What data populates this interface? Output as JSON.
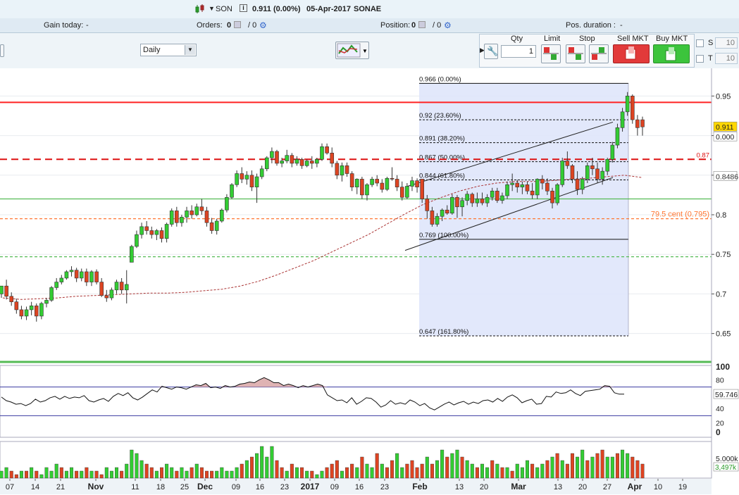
{
  "header": {
    "symbol": "SON",
    "price_info": "0.911 (0.00%)",
    "date": "05-Apr-2017",
    "name": "SONAE",
    "gain_label": "Gain today:",
    "gain_value": "-",
    "orders_label": "Orders:",
    "orders_value": "0",
    "orders_slash": "/ 0",
    "position_label": "Position:",
    "position_value": "0",
    "position_slash": "/ 0",
    "duration_label": "Pos. duration :",
    "duration_value": "-"
  },
  "toolbar": {
    "interval": "Daily",
    "qty_label": "Qty",
    "qty_value": "1",
    "limit_label": "Limit",
    "stop_label": "Stop",
    "sell_label": "Sell MKT",
    "buy_label": "Buy MKT",
    "s_label": "S",
    "s_value": "10",
    "t_label": "T",
    "t_value": "10"
  },
  "colors": {
    "up": "#33cc33",
    "down": "#dd4422",
    "resistance": "#ff2222",
    "ma": "#aa3333",
    "fib_fill": "#dfe5fb",
    "price_tag": "#ffd700"
  },
  "chart_data": [
    {
      "type": "candlestick",
      "x_ticks": [
        "07",
        "14",
        "21",
        "Nov",
        "11",
        "18",
        "25",
        "Dec",
        "09",
        "16",
        "23",
        "2017",
        "09",
        "16",
        "23",
        "Feb",
        "13",
        "20",
        "Mar",
        "13",
        "20",
        "27",
        "Apr",
        "10",
        "19"
      ],
      "y_ticks": [
        "0.95",
        "0.9",
        "0.85",
        "0.8",
        "0.75",
        "0.7",
        "0.65"
      ],
      "ylim": [
        0.615,
        0.985
      ],
      "candles": [
        [
          0.7,
          0.71,
          0.695,
          0.71
        ],
        [
          0.71,
          0.718,
          0.693,
          0.697
        ],
        [
          0.697,
          0.702,
          0.685,
          0.69
        ],
        [
          0.69,
          0.694,
          0.675,
          0.68
        ],
        [
          0.68,
          0.685,
          0.668,
          0.672
        ],
        [
          0.672,
          0.684,
          0.667,
          0.68
        ],
        [
          0.68,
          0.69,
          0.673,
          0.685
        ],
        [
          0.685,
          0.688,
          0.665,
          0.672
        ],
        [
          0.672,
          0.69,
          0.668,
          0.688
        ],
        [
          0.688,
          0.695,
          0.683,
          0.692
        ],
        [
          0.692,
          0.71,
          0.69,
          0.708
        ],
        [
          0.708,
          0.72,
          0.705,
          0.715
        ],
        [
          0.715,
          0.724,
          0.712,
          0.72
        ],
        [
          0.72,
          0.73,
          0.718,
          0.728
        ],
        [
          0.728,
          0.735,
          0.722,
          0.73
        ],
        [
          0.73,
          0.733,
          0.715,
          0.72
        ],
        [
          0.72,
          0.732,
          0.716,
          0.728
        ],
        [
          0.728,
          0.732,
          0.71,
          0.715
        ],
        [
          0.715,
          0.73,
          0.71,
          0.728
        ],
        [
          0.728,
          0.731,
          0.712,
          0.715
        ],
        [
          0.715,
          0.72,
          0.696,
          0.698
        ],
        [
          0.698,
          0.705,
          0.69,
          0.695
        ],
        [
          0.695,
          0.708,
          0.692,
          0.705
        ],
        [
          0.705,
          0.718,
          0.7,
          0.715
        ],
        [
          0.715,
          0.72,
          0.7,
          0.705
        ],
        [
          0.705,
          0.73,
          0.688,
          0.712
        ],
        [
          0.74,
          0.762,
          0.74,
          0.76
        ],
        [
          0.76,
          0.78,
          0.758,
          0.775
        ],
        [
          0.775,
          0.79,
          0.77,
          0.785
        ],
        [
          0.785,
          0.792,
          0.775,
          0.78
        ],
        [
          0.78,
          0.785,
          0.77,
          0.775
        ],
        [
          0.775,
          0.782,
          0.768,
          0.78
        ],
        [
          0.78,
          0.784,
          0.765,
          0.77
        ],
        [
          0.77,
          0.79,
          0.765,
          0.788
        ],
        [
          0.788,
          0.808,
          0.785,
          0.805
        ],
        [
          0.805,
          0.81,
          0.785,
          0.79
        ],
        [
          0.79,
          0.8,
          0.785,
          0.797
        ],
        [
          0.797,
          0.81,
          0.79,
          0.805
        ],
        [
          0.805,
          0.812,
          0.795,
          0.8
        ],
        [
          0.8,
          0.814,
          0.798,
          0.81
        ],
        [
          0.81,
          0.82,
          0.8,
          0.805
        ],
        [
          0.805,
          0.81,
          0.785,
          0.79
        ],
        [
          0.79,
          0.796,
          0.776,
          0.78
        ],
        [
          0.78,
          0.795,
          0.775,
          0.792
        ],
        [
          0.792,
          0.808,
          0.79,
          0.806
        ],
        [
          0.806,
          0.826,
          0.803,
          0.822
        ],
        [
          0.822,
          0.84,
          0.82,
          0.838
        ],
        [
          0.838,
          0.856,
          0.835,
          0.852
        ],
        [
          0.852,
          0.86,
          0.84,
          0.845
        ],
        [
          0.845,
          0.855,
          0.838,
          0.85
        ],
        [
          0.85,
          0.856,
          0.83,
          0.835
        ],
        [
          0.835,
          0.852,
          0.815,
          0.848
        ],
        [
          0.848,
          0.862,
          0.845,
          0.858
        ],
        [
          0.858,
          0.874,
          0.855,
          0.872
        ],
        [
          0.872,
          0.885,
          0.865,
          0.88
        ],
        [
          0.88,
          0.882,
          0.862,
          0.865
        ],
        [
          0.865,
          0.872,
          0.86,
          0.868
        ],
        [
          0.868,
          0.882,
          0.865,
          0.875
        ],
        [
          0.875,
          0.878,
          0.86,
          0.865
        ],
        [
          0.865,
          0.874,
          0.862,
          0.87
        ],
        [
          0.87,
          0.872,
          0.858,
          0.862
        ],
        [
          0.862,
          0.87,
          0.86,
          0.868
        ],
        [
          0.868,
          0.874,
          0.858,
          0.865
        ],
        [
          0.865,
          0.872,
          0.86,
          0.87
        ],
        [
          0.87,
          0.89,
          0.868,
          0.886
        ],
        [
          0.886,
          0.89,
          0.876,
          0.878
        ],
        [
          0.878,
          0.885,
          0.86,
          0.865
        ],
        [
          0.865,
          0.868,
          0.845,
          0.85
        ],
        [
          0.85,
          0.866,
          0.842,
          0.862
        ],
        [
          0.862,
          0.866,
          0.848,
          0.852
        ],
        [
          0.852,
          0.855,
          0.83,
          0.835
        ],
        [
          0.835,
          0.846,
          0.826,
          0.845
        ],
        [
          0.845,
          0.848,
          0.82,
          0.825
        ],
        [
          0.825,
          0.84,
          0.818,
          0.838
        ],
        [
          0.838,
          0.848,
          0.835,
          0.845
        ],
        [
          0.845,
          0.85,
          0.836,
          0.84
        ],
        [
          0.84,
          0.845,
          0.828,
          0.832
        ],
        [
          0.832,
          0.848,
          0.83,
          0.846
        ],
        [
          0.846,
          0.86,
          0.843,
          0.845
        ],
        [
          0.845,
          0.85,
          0.83,
          0.835
        ],
        [
          0.835,
          0.842,
          0.818,
          0.822
        ],
        [
          0.822,
          0.84,
          0.82,
          0.836
        ],
        [
          0.836,
          0.848,
          0.83,
          0.843
        ],
        [
          0.843,
          0.846,
          0.828,
          0.835
        ],
        [
          0.845,
          0.845,
          0.815,
          0.82
        ],
        [
          0.82,
          0.825,
          0.795,
          0.805
        ],
        [
          0.805,
          0.81,
          0.785,
          0.788
        ],
        [
          0.788,
          0.802,
          0.785,
          0.798
        ],
        [
          0.798,
          0.808,
          0.792,
          0.806
        ],
        [
          0.806,
          0.812,
          0.8,
          0.802
        ],
        [
          0.802,
          0.826,
          0.8,
          0.822
        ],
        [
          0.822,
          0.825,
          0.796,
          0.81
        ],
        [
          0.81,
          0.822,
          0.798,
          0.818
        ],
        [
          0.818,
          0.83,
          0.812,
          0.826
        ],
        [
          0.826,
          0.828,
          0.81,
          0.815
        ],
        [
          0.815,
          0.828,
          0.81,
          0.82
        ],
        [
          0.82,
          0.828,
          0.812,
          0.815
        ],
        [
          0.815,
          0.826,
          0.81,
          0.822
        ],
        [
          0.822,
          0.834,
          0.818,
          0.83
        ],
        [
          0.83,
          0.834,
          0.815,
          0.818
        ],
        [
          0.818,
          0.828,
          0.814,
          0.824
        ],
        [
          0.824,
          0.842,
          0.82,
          0.838
        ],
        [
          0.838,
          0.852,
          0.83,
          0.84
        ],
        [
          0.84,
          0.844,
          0.828,
          0.835
        ],
        [
          0.835,
          0.842,
          0.826,
          0.838
        ],
        [
          0.838,
          0.842,
          0.826,
          0.83
        ],
        [
          0.83,
          0.84,
          0.82,
          0.825
        ],
        [
          0.825,
          0.846,
          0.82,
          0.845
        ],
        [
          0.845,
          0.85,
          0.832,
          0.84
        ],
        [
          0.84,
          0.846,
          0.825,
          0.83
        ],
        [
          0.83,
          0.834,
          0.808,
          0.815
        ],
        [
          0.815,
          0.84,
          0.812,
          0.838
        ],
        [
          0.838,
          0.872,
          0.835,
          0.868
        ],
        [
          0.868,
          0.88,
          0.858,
          0.862
        ],
        [
          0.862,
          0.864,
          0.84,
          0.845
        ],
        [
          0.845,
          0.855,
          0.825,
          0.832
        ],
        [
          0.832,
          0.848,
          0.826,
          0.845
        ],
        [
          0.845,
          0.866,
          0.84,
          0.862
        ],
        [
          0.862,
          0.872,
          0.85,
          0.858
        ],
        [
          0.858,
          0.866,
          0.84,
          0.845
        ],
        [
          0.845,
          0.86,
          0.838,
          0.855
        ],
        [
          0.855,
          0.872,
          0.85,
          0.87
        ],
        [
          0.87,
          0.892,
          0.866,
          0.888
        ],
        [
          0.888,
          0.915,
          0.884,
          0.91
        ],
        [
          0.91,
          0.935,
          0.905,
          0.93
        ],
        [
          0.93,
          0.955,
          0.925,
          0.95
        ],
        [
          0.95,
          0.952,
          0.915,
          0.92
        ],
        [
          0.92,
          0.926,
          0.9,
          0.91
        ],
        [
          0.92,
          0.924,
          0.9,
          0.911
        ]
      ],
      "moving_average": [
        0.695,
        0.693,
        0.694,
        0.695,
        0.697,
        0.698,
        0.699,
        0.7,
        0.701,
        0.701,
        0.702,
        0.704,
        0.706,
        0.71,
        0.716,
        0.724,
        0.733,
        0.742,
        0.753,
        0.764,
        0.775,
        0.788,
        0.801,
        0.813,
        0.822,
        0.83,
        0.836,
        0.84,
        0.842,
        0.842,
        0.843,
        0.845,
        0.846,
        0.848,
        0.85,
        0.847
      ],
      "fibonacci": [
        {
          "label": "0.966 (0.00%)",
          "value": 0.966
        },
        {
          "label": "0.92 (23.60%)",
          "value": 0.92
        },
        {
          "label": "0.891 (38.20%)",
          "value": 0.891
        },
        {
          "label": "0.867 (50.00%)",
          "value": 0.867
        },
        {
          "label": "0.844 (61.80%)",
          "value": 0.844
        },
        {
          "label": "0.769 (100.00%)",
          "value": 0.769
        },
        {
          "label": "0.647 (161.80%)",
          "value": 0.647
        }
      ],
      "levels": [
        {
          "value": 0.942,
          "style": "solid",
          "color": "#ff2222"
        },
        {
          "value": 0.87,
          "style": "dashed",
          "color": "#dd1111",
          "label": "0.87"
        },
        {
          "value": 0.795,
          "style": "dashed",
          "color": "#ff7733",
          "label": "79.5 cent (0.795)"
        },
        {
          "value": 0.82,
          "style": "solid",
          "color": "#55bb55"
        },
        {
          "value": 0.747,
          "style": "dashed",
          "color": "#55bb55"
        }
      ],
      "channel": {
        "upper": [
          [
            0.835,
            0.917
          ]
        ],
        "lower": [
          [
            0.755,
            0.847
          ]
        ]
      },
      "price_tags": [
        "0.911",
        "0.000",
        "0.8486"
      ]
    },
    {
      "type": "line",
      "indicator": "RSI",
      "y_ticks": [
        "100",
        "80",
        "60",
        "40",
        "20",
        "0"
      ],
      "ylim": [
        0,
        100
      ],
      "upper_band": 70,
      "lower_band": 30,
      "last_value": "59.746",
      "values": [
        56,
        51,
        49,
        46,
        47,
        44,
        47,
        53,
        49,
        51,
        55,
        57,
        53,
        57,
        54,
        56,
        55,
        58,
        51,
        49,
        52,
        54,
        50,
        57,
        61,
        58,
        62,
        55,
        52,
        56,
        61,
        66,
        63,
        71,
        69,
        67,
        70,
        69,
        67,
        70,
        73,
        72,
        75,
        69,
        70,
        68,
        72,
        70,
        71,
        74,
        75,
        77,
        76,
        80,
        83,
        80,
        76,
        76,
        72,
        74,
        72,
        69,
        72,
        70,
        72,
        74,
        72,
        59,
        55,
        51,
        52,
        48,
        55,
        46,
        50,
        55,
        54,
        49,
        42,
        45,
        51,
        46,
        48,
        46,
        52,
        49,
        44,
        47,
        41,
        38,
        42,
        46,
        49,
        45,
        48,
        50,
        46,
        49,
        47,
        51,
        52,
        49,
        54,
        50,
        56,
        59,
        55,
        48,
        51,
        53,
        46,
        47,
        57,
        56,
        63,
        61,
        62,
        66,
        61,
        58,
        64,
        65,
        66,
        67,
        72,
        71,
        62,
        60,
        60
      ]
    },
    {
      "type": "bar",
      "indicator": "Volume",
      "y_ticks": [
        "5.000k"
      ],
      "last_value": "3,497k",
      "values": [
        2,
        3,
        2,
        1,
        2,
        2,
        3,
        2,
        1,
        3,
        2,
        4,
        3,
        2,
        3,
        2,
        2,
        3,
        2,
        2,
        1,
        3,
        2,
        3,
        2,
        4,
        8,
        7,
        5,
        4,
        3,
        2,
        3,
        4,
        3,
        2,
        3,
        2,
        3,
        4,
        3,
        2,
        2,
        2,
        3,
        2,
        2,
        3,
        4,
        5,
        6,
        7,
        9,
        6,
        9,
        5,
        3,
        2,
        4,
        3,
        3,
        2,
        2,
        1,
        2,
        3,
        4,
        5,
        2,
        3,
        4,
        3,
        6,
        4,
        3,
        7,
        4,
        3,
        5,
        7,
        3,
        4,
        5,
        3,
        4,
        6,
        4,
        5,
        8,
        6,
        7,
        8,
        6,
        5,
        4,
        3,
        4,
        3,
        5,
        4,
        3,
        3,
        2,
        4,
        3,
        5,
        4,
        3,
        4,
        5,
        6,
        7,
        5,
        4,
        7,
        6,
        8,
        5,
        6,
        7,
        8,
        6,
        6,
        7,
        8,
        7,
        6,
        5,
        4
      ],
      "up": [
        1,
        1,
        0,
        0,
        1,
        0,
        1,
        0,
        1,
        1,
        1,
        1,
        0,
        1,
        1,
        0,
        1,
        0,
        1,
        0,
        0,
        1,
        1,
        1,
        0,
        1,
        1,
        1,
        1,
        0,
        0,
        1,
        0,
        1,
        1,
        0,
        1,
        1,
        0,
        1,
        0,
        0,
        0,
        1,
        1,
        1,
        1,
        1,
        0,
        1,
        0,
        1,
        1,
        1,
        1,
        0,
        0,
        1,
        0,
        1,
        0,
        1,
        0,
        1,
        1,
        0,
        0,
        0,
        1,
        0,
        0,
        1,
        0,
        1,
        1,
        0,
        1,
        0,
        0,
        1,
        1,
        0,
        0,
        0,
        0,
        1,
        0,
        1,
        1,
        0,
        1,
        1,
        0,
        1,
        1,
        0,
        1,
        1,
        0,
        1,
        0,
        1,
        0,
        1,
        1,
        1,
        0,
        1,
        1,
        0,
        1,
        0,
        1,
        0,
        0,
        1,
        1,
        0,
        1,
        0,
        0,
        1,
        1,
        0,
        1,
        1,
        0,
        0,
        0
      ]
    }
  ]
}
